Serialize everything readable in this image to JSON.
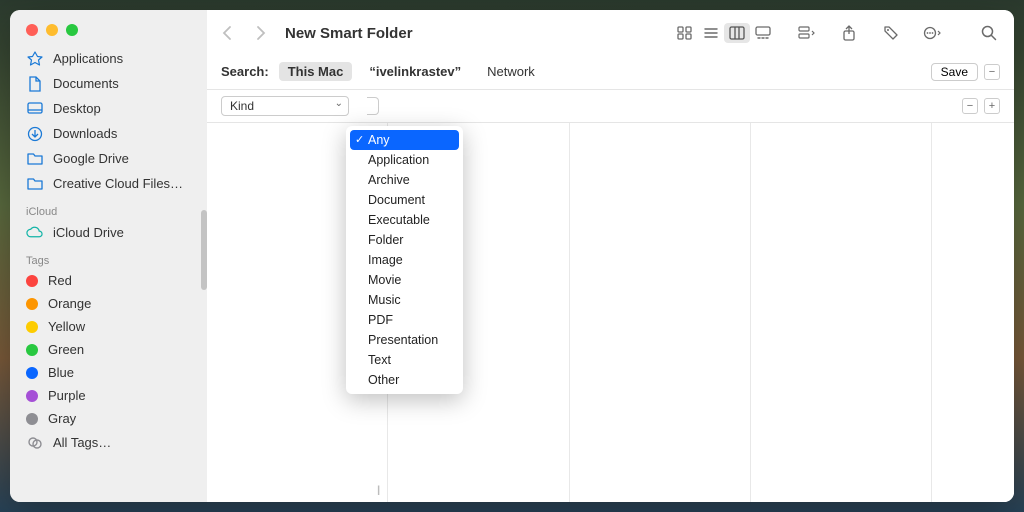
{
  "window": {
    "title": "New Smart Folder"
  },
  "traffic_lights": {
    "close": "#ff5f57",
    "min": "#febc2e",
    "max": "#28c840"
  },
  "sidebar": {
    "favorites": [
      {
        "label": "Applications",
        "icon": "apps-icon"
      },
      {
        "label": "Documents",
        "icon": "doc-icon"
      },
      {
        "label": "Desktop",
        "icon": "desktop-icon"
      },
      {
        "label": "Downloads",
        "icon": "downloads-icon"
      },
      {
        "label": "Google Drive",
        "icon": "folder-icon"
      },
      {
        "label": "Creative Cloud Files…",
        "icon": "folder-icon"
      }
    ],
    "icloud_section": "iCloud",
    "icloud": [
      {
        "label": "iCloud Drive",
        "icon": "cloud-icon"
      }
    ],
    "tags_section": "Tags",
    "tags": [
      {
        "label": "Red",
        "color": "#fc443f"
      },
      {
        "label": "Orange",
        "color": "#fd9500"
      },
      {
        "label": "Yellow",
        "color": "#fdcc00"
      },
      {
        "label": "Green",
        "color": "#28c840"
      },
      {
        "label": "Blue",
        "color": "#0a66ff"
      },
      {
        "label": "Purple",
        "color": "#a550d6"
      },
      {
        "label": "Gray",
        "color": "#8e8e93"
      }
    ],
    "all_tags": "All Tags…"
  },
  "searchbar": {
    "label": "Search:",
    "scopes": [
      {
        "label": "This Mac",
        "active": true
      },
      {
        "label": "“ivelinkrastev”",
        "active": false
      },
      {
        "label": "Network",
        "active": false
      }
    ],
    "save": "Save"
  },
  "criteria": {
    "field": "Kind"
  },
  "dropdown": {
    "selected": "Any",
    "items": [
      "Any",
      "Application",
      "Archive",
      "Document",
      "Executable",
      "Folder",
      "Image",
      "Movie",
      "Music",
      "PDF",
      "Presentation",
      "Text",
      "Other"
    ]
  }
}
